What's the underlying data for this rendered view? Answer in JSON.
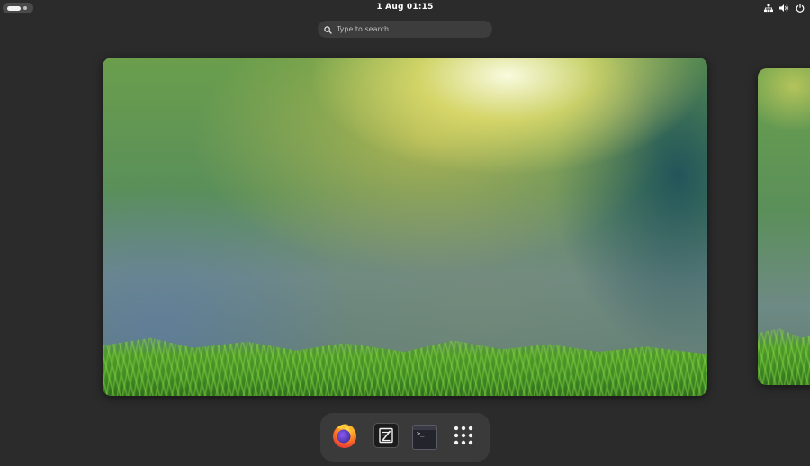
{
  "topbar": {
    "clock": "1 Aug  01:15",
    "activities_icon": "activities-pill-icon",
    "tray_icons": [
      "network-icon",
      "volume-icon",
      "power-icon"
    ]
  },
  "search": {
    "placeholder": "Type to search",
    "icon": "search-icon"
  },
  "workspaces": [
    {
      "name": "workspace-1",
      "state": "active",
      "wallpaper": "green moss with sunlight bokeh"
    },
    {
      "name": "workspace-2",
      "state": "partially visible"
    }
  ],
  "dash": {
    "apps": [
      {
        "name": "Firefox",
        "icon": "firefox-icon"
      },
      {
        "name": "Text Editor",
        "icon": "text-editor-icon"
      },
      {
        "name": "Terminal",
        "icon": "terminal-icon"
      },
      {
        "name": "Show Applications",
        "icon": "app-grid-icon"
      }
    ]
  },
  "colors": {
    "background": "#2b2b2b",
    "search_bg": "#3d3d3d",
    "dash_bg": "#3a3a3a"
  }
}
